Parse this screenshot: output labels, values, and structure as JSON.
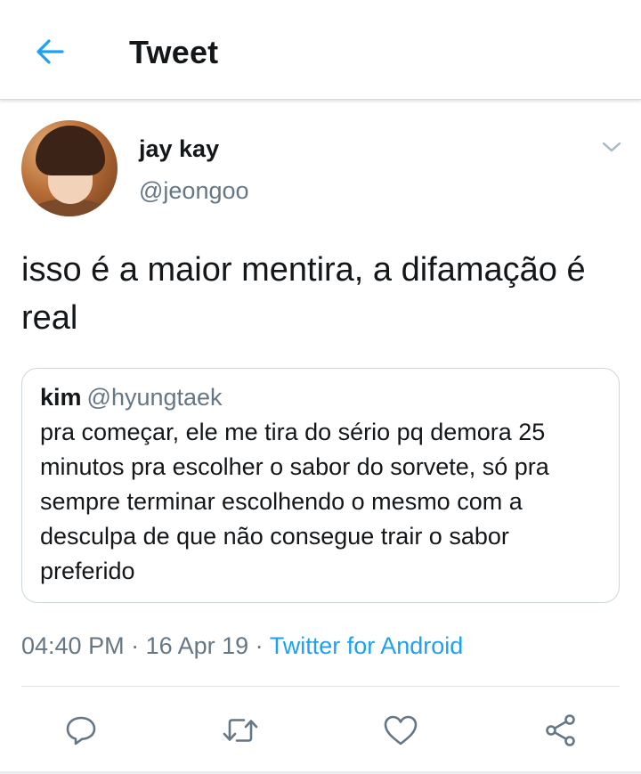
{
  "header": {
    "title": "Tweet",
    "back_icon": "back-arrow-icon"
  },
  "author": {
    "display_name": "jay kay",
    "handle": "@jeongoo"
  },
  "tweet": {
    "text": "isso é a maior mentira, a difamação é real"
  },
  "quoted_tweet": {
    "name": "kim",
    "handle": "@hyungtaek",
    "text": "pra começar, ele me tira do sério pq demora 25 minutos pra escolher o sabor do sorvete, só pra sempre terminar escolhendo o mesmo com a desculpa de que não consegue trair o sabor preferido"
  },
  "meta": {
    "time": "04:40 PM",
    "separator": " · ",
    "date": "16 Apr 19",
    "source": "Twitter for Android"
  },
  "actions": {
    "reply_icon": "reply-icon",
    "retweet_icon": "retweet-icon",
    "like_icon": "heart-icon",
    "share_icon": "share-icon"
  },
  "colors": {
    "accent": "#1da1f2",
    "secondary_text": "#657786",
    "border": "#ccd6dd"
  }
}
